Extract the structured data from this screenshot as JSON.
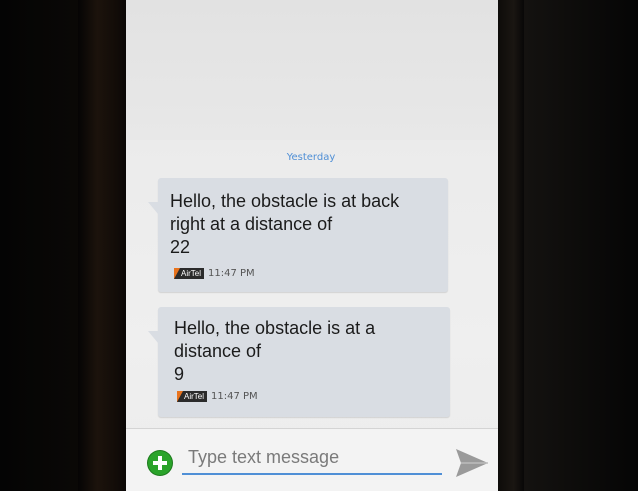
{
  "conversation": {
    "date_separator": "Yesterday",
    "messages": [
      {
        "text": "Hello, the obstacle is at back\nright at a distance of\n22",
        "carrier": "AirTel",
        "time": "11:47 PM"
      },
      {
        "text": "Hello, the obstacle is at a\ndistance of\n9",
        "carrier": "AirTel",
        "time": "11:47 PM"
      }
    ]
  },
  "compose": {
    "placeholder": "Type text message",
    "add_icon": "plus-circle-icon",
    "send_icon": "send-arrow-icon"
  },
  "colors": {
    "accent": "#4f8fd6",
    "bubble": "#d9dde3",
    "add_button": "#2aa32a",
    "carrier_badge": "#e8731d"
  }
}
